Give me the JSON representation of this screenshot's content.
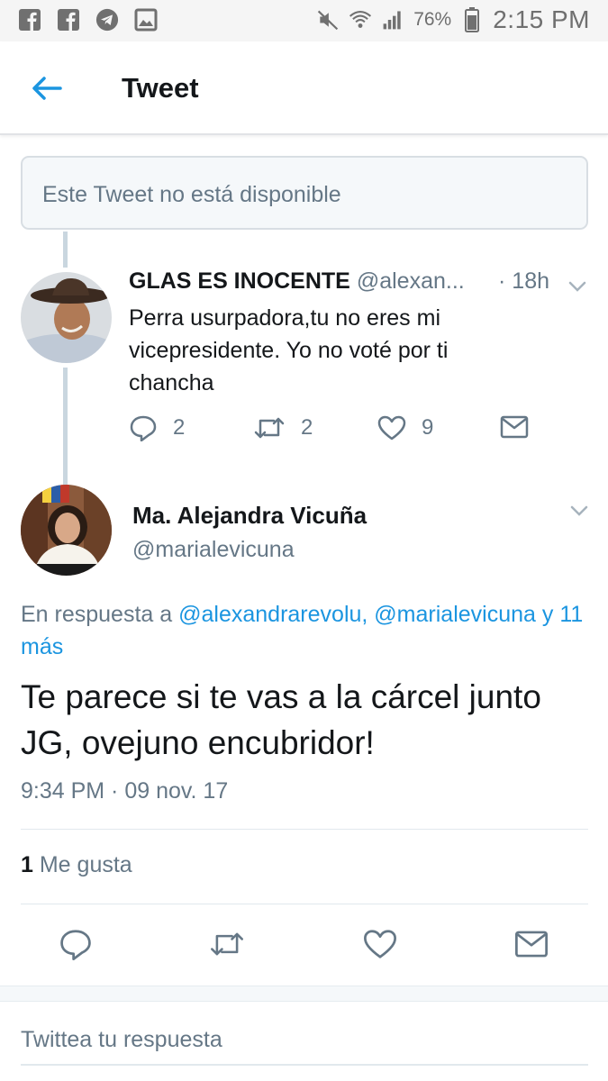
{
  "status_bar": {
    "battery_percent": "76%",
    "time": "2:15 PM",
    "icons": [
      "facebook-icon",
      "facebook-icon",
      "telegram-icon",
      "image-icon",
      "mute-icon",
      "wifi-icon",
      "signal-icon",
      "battery-icon"
    ]
  },
  "header": {
    "title": "Tweet"
  },
  "unavailable": {
    "text": "Este Tweet no está disponible"
  },
  "reply_tweet": {
    "name": "GLAS ES INOCENTE",
    "handle": "@alexan...",
    "time": "· 18h",
    "text": "Perra usurpadora,tu no eres mi vicepresidente. Yo no voté por ti chancha",
    "reply_count": "2",
    "retweet_count": "2",
    "like_count": "9"
  },
  "main_tweet": {
    "name": "Ma. Alejandra Vicuña",
    "handle": "@marialevicuna",
    "in_reply_prefix": "En respuesta a",
    "in_reply_user1": "@alexandrarevolu,",
    "in_reply_user2": "@marialevicuna",
    "in_reply_more": "y 11 más",
    "text": "Te parece si te vas a la cárcel junto JG, ovejuno encubridor!",
    "timestamp": "9:34 PM · 09 nov. 17",
    "likes_count": "1",
    "likes_label": "Me gusta"
  },
  "compose": {
    "placeholder": "Twittea tu respuesta"
  },
  "colors": {
    "accent": "#1b95e0",
    "secondary_text": "#657786",
    "primary_text": "#14171a",
    "thread_line": "#c9d6df"
  }
}
